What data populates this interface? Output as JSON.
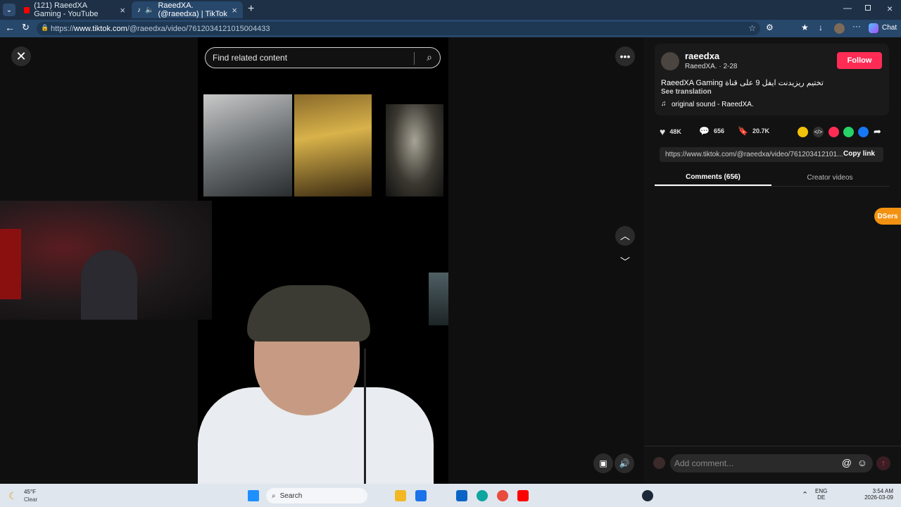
{
  "browser": {
    "tabs": [
      {
        "label": "(121) RaeedXA Gaming - YouTube"
      },
      {
        "label": "RaeedXA. (@raeedxa) | TikTok"
      }
    ],
    "url_prefix": "https://",
    "url_domain": "www.tiktok.com",
    "url_path": "/@raeedxa/video/7612034121015004433",
    "chat_label": "Chat"
  },
  "player": {
    "search_placeholder": "Find related content"
  },
  "author": {
    "username": "raeedxa",
    "nickname_date": "RaeedXA. · 2-28",
    "follow_label": "Follow",
    "description": "RaeedXA Gaming تختيم ريزيدنت ايفل 9 على قناة",
    "see_translation": "See translation",
    "sound": "original sound - RaeedXA."
  },
  "stats": {
    "likes": "48K",
    "comments": "656",
    "saves": "20.7K"
  },
  "link": {
    "url": "https://www.tiktok.com/@raeedxa/video/761203412101...",
    "copy_label": "Copy link"
  },
  "tabs": {
    "comments": "Comments (656)",
    "creator": "Creator videos"
  },
  "extension_badge": "DSers",
  "comment_input": {
    "placeholder": "Add comment..."
  },
  "taskbar": {
    "weather_temp": "45°F",
    "weather_desc": "Clear",
    "search_label": "Search",
    "lang1": "ENG",
    "lang2": "DE",
    "time": "3:54 AM",
    "date": "2026-03-09"
  },
  "colors": {
    "accent": "#fe2c55",
    "browser_bar": "#27476b"
  }
}
